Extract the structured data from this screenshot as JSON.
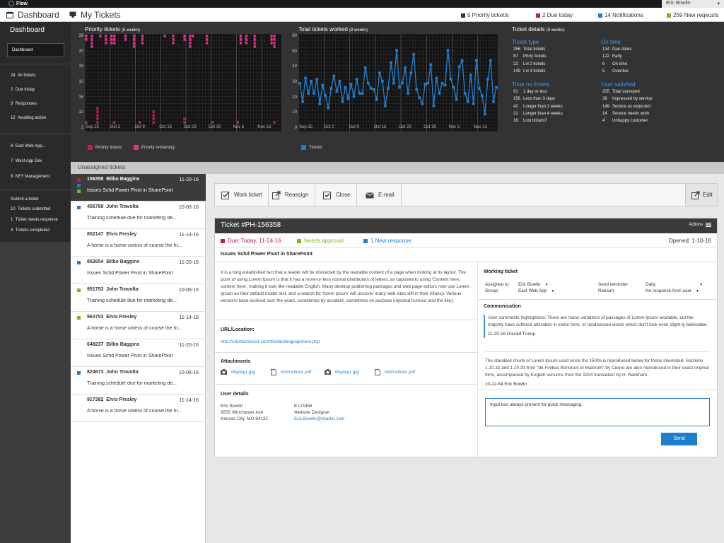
{
  "app": {
    "brand": "Flow",
    "user": "Eric Bowlin",
    "user_caret": "▾"
  },
  "nav": {
    "dashboard_label": "Dashboard",
    "tickets_label": "My Tickets",
    "stats": [
      {
        "label": "5 Priority ticket/s",
        "color": "#333333"
      },
      {
        "label": "2 Due today",
        "color": "#c8185c"
      },
      {
        "label": "14 Notifications",
        "color": "#1f7fcf"
      },
      {
        "label": "259 New reqeusts",
        "color": "#7ab51d"
      }
    ]
  },
  "sidebar": {
    "title": "Dashboard",
    "active": "Dashboard",
    "group1": [
      {
        "count": "24",
        "label": "All tickets"
      },
      {
        "count": "2",
        "label": "Due today"
      },
      {
        "count": "3",
        "label": "Responses"
      },
      {
        "count": "12",
        "label": "Awaiting action"
      }
    ],
    "group2": [
      {
        "count": "8",
        "label": "East Web App..."
      },
      {
        "count": "7",
        "label": "West App Dev"
      },
      {
        "count": "9",
        "label": "KEY Management"
      }
    ],
    "submit": "Submit a ticket",
    "group3": [
      {
        "count": "10",
        "label": "Tickets submitted"
      },
      {
        "count": "1",
        "label": "Ticket needs response"
      },
      {
        "count": "4",
        "label": "Tickets completed"
      }
    ]
  },
  "chart_data": [
    {
      "type": "bar",
      "title": "Priority tickets",
      "subtitle": "(8 weeks)",
      "y_ticks": [
        "28",
        "20",
        "19",
        "10",
        "15",
        "10",
        "2"
      ],
      "x_ticks": [
        "Sep 25",
        "Oct 2",
        "Oct 9",
        "Oct 16",
        "Oct 23",
        "Oct 30",
        "Nov 6",
        "Nov 13"
      ],
      "series": [
        {
          "name": "Priority tickets",
          "color": "#c8185c",
          "values": [
            1,
            0,
            0,
            0,
            5,
            0,
            0,
            0,
            0,
            0,
            1,
            0,
            0,
            0,
            0,
            0,
            0,
            0,
            0,
            1,
            0,
            0,
            0,
            0,
            4,
            0,
            0,
            0,
            0,
            0,
            0,
            0,
            0,
            0,
            0,
            2,
            0,
            0,
            0,
            0,
            0,
            0,
            0,
            0,
            0,
            1,
            0,
            0,
            0,
            0,
            0,
            0,
            0,
            0,
            1,
            0,
            0,
            0,
            0,
            0,
            0,
            0,
            0,
            0,
            0,
            0,
            0,
            1,
            0,
            0
          ]
        },
        {
          "name": "Priority remaining",
          "color": "#e0338b",
          "values": [
            2,
            0,
            4,
            0,
            0,
            1,
            0,
            3,
            0,
            3,
            3,
            0,
            0,
            0,
            2,
            0,
            0,
            4,
            0,
            0,
            3,
            0,
            0,
            0,
            0,
            0,
            0,
            0,
            1,
            0,
            0,
            3,
            0,
            0,
            0,
            2,
            0,
            4,
            1,
            0,
            0,
            0,
            0,
            3,
            0,
            0,
            0,
            0,
            0,
            0,
            0,
            0,
            0,
            0,
            0,
            3,
            0,
            3,
            0,
            0,
            4,
            0,
            0,
            0,
            0,
            0,
            3,
            4,
            0,
            0
          ]
        }
      ]
    },
    {
      "type": "line",
      "title": "Total tickets worked",
      "subtitle": "(8 weeks)",
      "y_ticks": [
        "80",
        "50",
        "40",
        "30",
        "20",
        "10",
        "0"
      ],
      "ylim": [
        0,
        85
      ],
      "x_ticks": [
        "Sep 25",
        "Oct 2",
        "Oct 9",
        "Oct 16",
        "Oct 23",
        "Oct 30",
        "Nov 6",
        "Nov 13"
      ],
      "series": [
        {
          "name": "Tickets",
          "color": "#1f7fcf",
          "values": [
            40,
            22,
            45,
            30,
            42,
            30,
            44,
            20,
            38,
            28,
            16,
            35,
            47,
            32,
            42,
            22,
            36,
            25,
            39,
            27,
            44,
            30,
            30,
            55,
            40,
            35,
            34,
            24,
            50,
            42,
            18,
            35,
            60,
            40,
            72,
            36,
            40,
            55,
            30,
            50,
            68,
            34,
            26,
            20,
            39,
            40,
            58,
            18,
            45,
            30,
            40,
            38,
            72,
            44,
            36,
            24,
            56,
            62,
            30,
            22,
            48,
            20,
            62,
            35,
            28,
            10,
            44,
            62,
            22,
            36
          ]
        }
      ]
    }
  ],
  "details": {
    "title": "Ticket details",
    "subtitle": "(8 weeks)",
    "ticket_type": {
      "header": "Ticket type",
      "rows": [
        [
          "256",
          "Total tickets"
        ],
        [
          "87",
          "Prirty tickets"
        ],
        [
          "22",
          "Lvl 2 tickets"
        ],
        [
          "149",
          "Lvl 3 tickets"
        ]
      ]
    },
    "on_time": {
      "header": "On time",
      "rows": [
        [
          "134",
          "Due dates"
        ],
        [
          "122",
          "Early"
        ],
        [
          "6",
          "On time"
        ],
        [
          "5",
          "Overdue"
        ]
      ]
    },
    "time_on_tickets": {
      "header": "Time on tickets",
      "rows": [
        [
          "91",
          "1 day or less"
        ],
        [
          "156",
          "Less than 3 days"
        ],
        [
          "42",
          "Longer than 2 weeks"
        ],
        [
          "21",
          "Longer than 4 weeks"
        ],
        [
          "16",
          "Lost tickets?"
        ]
      ]
    },
    "user_satisfied": {
      "header": "User satisfied",
      "rows": [
        [
          "205",
          "Total surveyed"
        ],
        [
          "36",
          "Impressed by service"
        ],
        [
          "149",
          "Service as expected"
        ],
        [
          "14",
          "Service needs work"
        ],
        [
          "4",
          "Unhappy customer"
        ]
      ]
    }
  },
  "list": {
    "header": "Unassigned tickets",
    "items": [
      {
        "id": "156358",
        "name": "Bilbo Baggins",
        "date": "11-20-16",
        "summary": "Issues Schd Power Pivot in SharePoint",
        "dots": [
          "#c8185c",
          "#1f7fcf",
          "#7ab51d"
        ]
      },
      {
        "id": "456789",
        "name": "John Travolta",
        "date": "10-06-16",
        "summary": "Training schedule due for marketing de...",
        "dots": [
          "#1f7fcf"
        ]
      },
      {
        "id": "852147",
        "name": "Elvis Presley",
        "date": "11-14-16",
        "summary": "A horse is a horse unless of course the hr...",
        "dots": []
      },
      {
        "id": "852654",
        "name": "Bilbo Baggins",
        "date": "11-20-16",
        "summary": "Issues Schd Power Pivot in SharePoint",
        "dots": [
          "#1f7fcf"
        ]
      },
      {
        "id": "951753",
        "name": "John Travolta",
        "date": "10-06-16",
        "summary": "Training schedule due for marketing de...",
        "dots": [
          "#7ab51d"
        ]
      },
      {
        "id": "963753",
        "name": "Elvis Presley",
        "date": "11-14-16",
        "summary": "A horse is a horse unless of course the hr...",
        "dots": [
          "#7ab51d"
        ]
      },
      {
        "id": "648237",
        "name": "Bilbo Baggins",
        "date": "11-20-16",
        "summary": "Issues Schd Power Pivot in SharePoint",
        "dots": []
      },
      {
        "id": "824673",
        "name": "John Travolta",
        "date": "10-06-16",
        "summary": "Training schedule due for marketing de...",
        "dots": [
          "#1f7fcf"
        ]
      },
      {
        "id": "917382",
        "name": "Elvis Presley",
        "date": "11-14-16",
        "summary": "A horse is a horse unless of course the hr...",
        "dots": []
      }
    ]
  },
  "toolbar": {
    "work": "Work ticket",
    "reassign": "Reassign",
    "close": "Close",
    "email": "E-mail",
    "edit": "Edit"
  },
  "ticket": {
    "title": "Ticket #PH-156358",
    "actions": "Actions",
    "due": "Due: Today, 11-24-16",
    "approval": "Needs approval",
    "response": "1 New response",
    "opened": "Opened: 1-10-16",
    "subject": "Issues Schd Power Pivot in SharePoint",
    "description": "It is a long established fact that a reader will be distracted by the readable content of a page when looking at its layout. The point of using Lorem Ipsum is that it has a more-or-less normal distribution of letters, as opposed to using 'Content here, content here', making it look like readable English. Many desktop publishing packages and web page editors now use Lorem Ipsum as their default model text, and a search for 'lorem ipsum' will uncover many web sites still in their infancy. Various versions have evolved over the years, sometimes by accident, sometimes on purpose (injected humour and the like).",
    "url_label": "URL/Location:",
    "url": "http://urlofsomesort.com/thislandingpagehere.php",
    "attachments_label": "Attachments",
    "attachments": [
      "display1.jpg",
      "instructions.pdf",
      "display1.jpg",
      "instructions.pdf"
    ],
    "user_details_label": "User details",
    "user_col1": [
      "Eric Bowlin",
      "6555 Winchester Ave",
      "Kansas City, MO 64131"
    ],
    "user_col2": [
      "E123456",
      "Website Designer",
      "Eric.Bowlin@charter.com"
    ],
    "working_label": "Working ticket",
    "assigned_label": "Assigned to:",
    "assigned_value": "Eric Bowlin",
    "group_label": "Group:",
    "group_value": "East Web App",
    "reminder_label": "Send reminder:",
    "reminder_value": "Daily",
    "reason_label": "Reason:",
    "reason_value": "No response from user",
    "comm_label": "Communication",
    "comm1_text": "User comments highlightesd. There are many variations of passages of Lorem Ipsum available, but the majority have suffered alteration in some form, or randomised words which don't look even slight-ly believable.",
    "comm1_by": "11-20-16 Donald Trump",
    "comm2_text": "The standard chunk of Lorem Ipsum used since the 1500s is reproduced below for those interested. Sections 1.10.32 and 1.10.33 from \"de Finibus Bonorum et Malorum\" by Cicero are also reproduced in their exact original form, accompanied by English versions from the 1914 translation by H. Rackham.",
    "comm2_by": "10-22-64 Eric Bowlin",
    "input_placeholder": "Input box always present for quick messaging.",
    "send": "Send"
  }
}
